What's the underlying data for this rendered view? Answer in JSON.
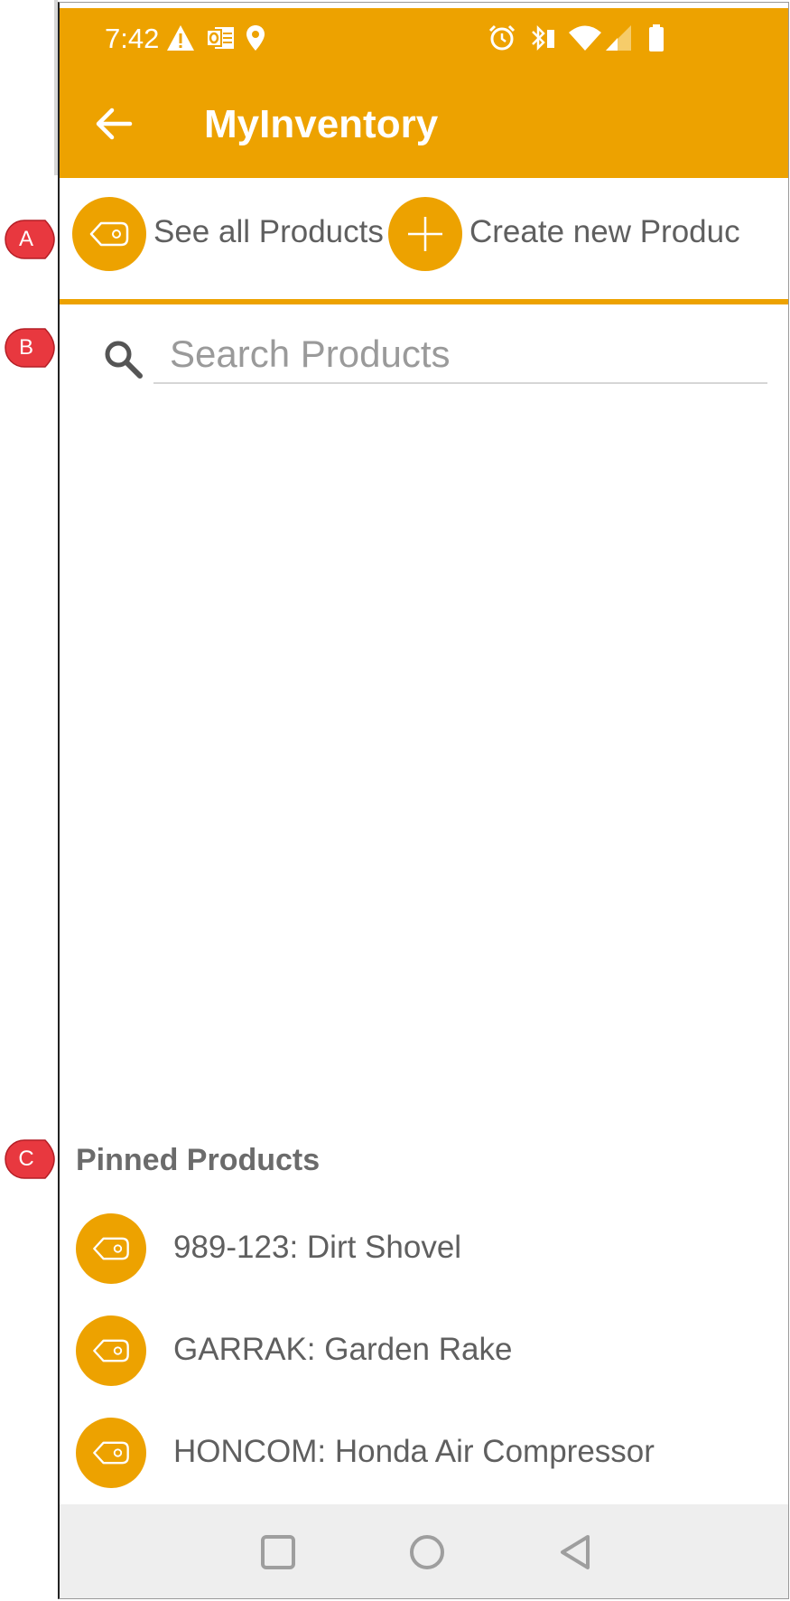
{
  "status_bar": {
    "time": "7:42",
    "icons": [
      "warning-icon",
      "outlook-icon",
      "location-icon",
      "alarm-icon",
      "bluetooth-icon",
      "wifi-icon",
      "signal-icon",
      "battery-icon"
    ]
  },
  "toolbar": {
    "title": "MyInventory",
    "back_icon": "arrow-back-icon"
  },
  "actions": {
    "see_all": "See all Products",
    "create_new": "Create new Produc"
  },
  "search": {
    "placeholder": "Search Products",
    "value": ""
  },
  "pinned": {
    "title": "Pinned Products",
    "items": [
      {
        "label": "989-123: Dirt Shovel"
      },
      {
        "label": "GARRAK: Garden Rake"
      },
      {
        "label": "HONCOM: Honda Air Compressor"
      }
    ]
  },
  "callouts": {
    "a": "A",
    "b": "B",
    "c": "C"
  },
  "colors": {
    "accent": "#eda200",
    "callout": "#e8383f",
    "text": "#5f5f5f"
  }
}
